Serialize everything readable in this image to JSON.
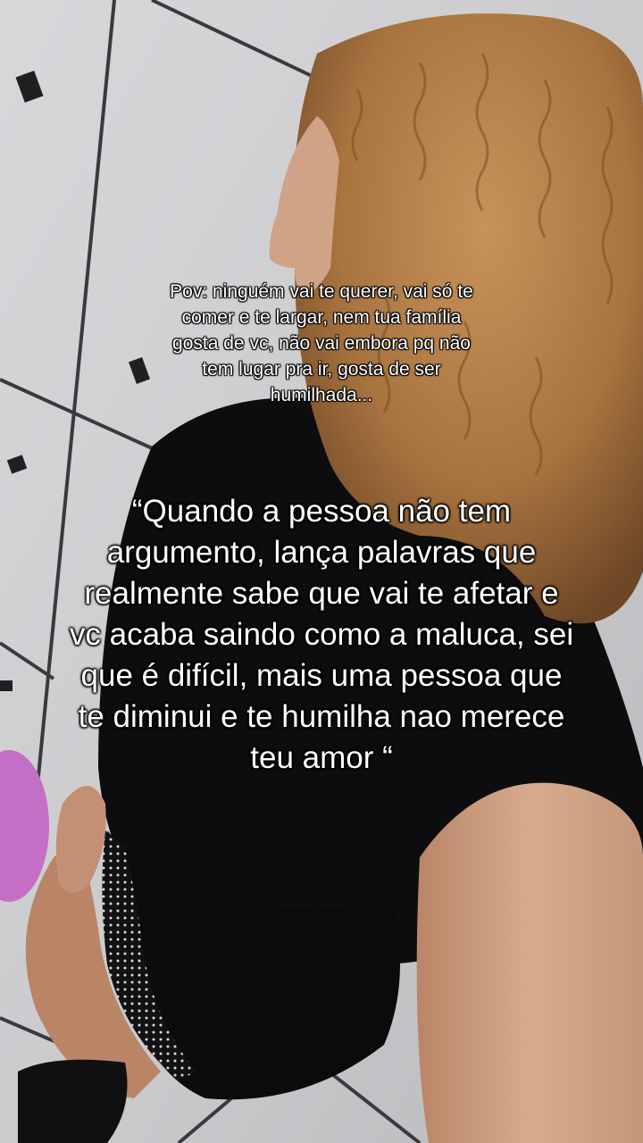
{
  "caption": {
    "pov_text": "Pov: ninguém vai te querer, vai só te\ncomer e te largar, nem tua família\ngosta de vc, não vai embora pq não\ntem lugar pra ir, gosta de ser\nhumilhada...",
    "quote_text": "“Quando a pessoa não tem\nargumento, lança palavras que\nrealmente sabe que vai te afetar e\nvc acaba saindo como a maluca, sei\nque é difícil, mais uma pessoa que\nte diminui e te humilha nao merece\nteu amor “"
  },
  "colors": {
    "tiles": "#d3d3d6",
    "grout": "#3a3a3e",
    "hair": "#b9854c",
    "shirt": "#0d0d0f",
    "skin": "#c99a7c"
  }
}
